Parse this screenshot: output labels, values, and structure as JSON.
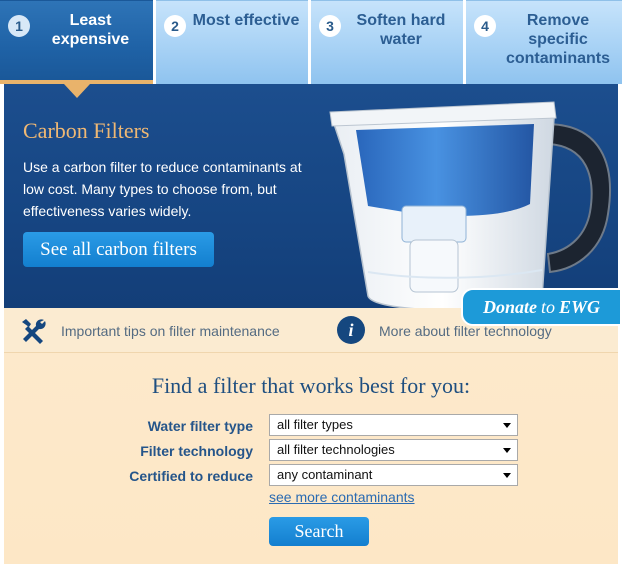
{
  "tabs": [
    {
      "num": "1",
      "label": "Least expensive"
    },
    {
      "num": "2",
      "label": "Most effective"
    },
    {
      "num": "3",
      "label": "Soften hard water"
    },
    {
      "num": "4",
      "label": "Remove specific contaminants"
    }
  ],
  "hero": {
    "title": "Carbon Filters",
    "description": "Use a carbon filter to reduce contaminants at low cost. Many types to choose from, but effectiveness varies widely.",
    "button": "See all carbon filters"
  },
  "donate": {
    "prefix": "Donate",
    "to": "to",
    "org": "EWG"
  },
  "tips": {
    "maintenance": "Important tips on filter maintenance",
    "technology": "More about filter technology"
  },
  "finder": {
    "title": "Find a filter that works best for you:",
    "type_label": "Water filter type",
    "type_value": "all filter types",
    "tech_label": "Filter technology",
    "tech_value": "all filter technologies",
    "cert_label": "Certified to reduce",
    "cert_value": "any contaminant",
    "more_link": "see more contaminants",
    "search_button": "Search"
  },
  "colors": {
    "active_tab": "#1f62a6",
    "inactive_tab": "#a8d2f5",
    "hero_bg": "#164582",
    "accent_orange": "#efb874",
    "button_blue": "#1a8ad8",
    "finder_bg": "#fde8c8"
  },
  "icons": {
    "tip_maintenance": "tools-icon",
    "tip_technology": "info-icon"
  }
}
